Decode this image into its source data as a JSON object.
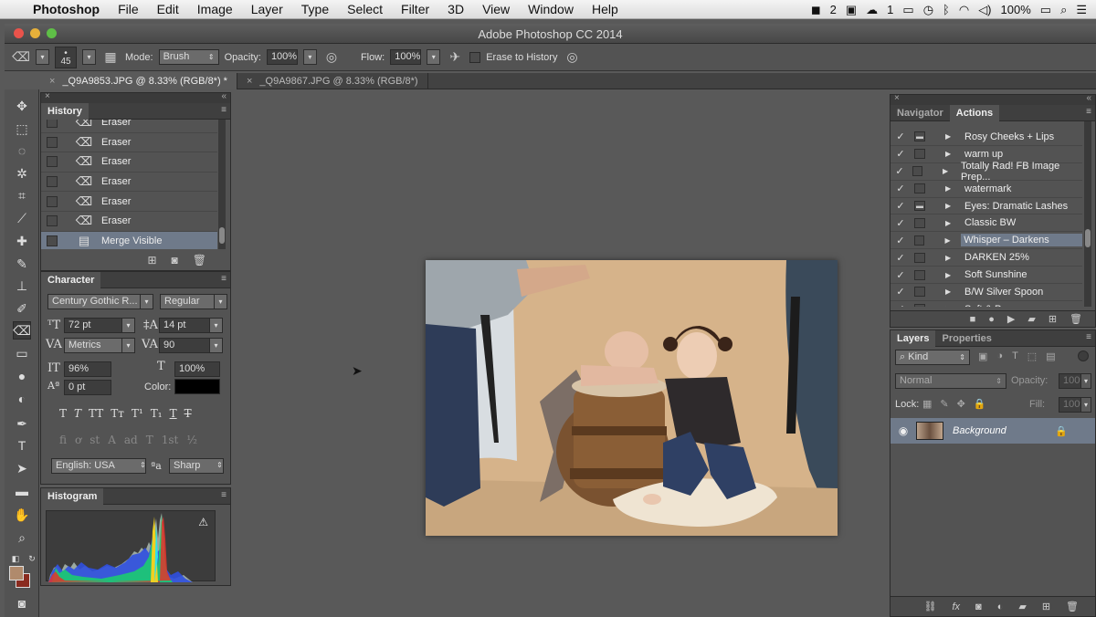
{
  "menubar": {
    "app": "Photoshop",
    "items": [
      "File",
      "Edit",
      "Image",
      "Layer",
      "Type",
      "Select",
      "Filter",
      "3D",
      "View",
      "Window",
      "Help"
    ],
    "status": {
      "badge_count": "2",
      "cloud_count": "1",
      "battery": "100%"
    }
  },
  "window": {
    "title": "Adobe Photoshop CC 2014"
  },
  "options": {
    "brush_size": "45",
    "mode_label": "Mode:",
    "mode_value": "Brush",
    "opacity_label": "Opacity:",
    "opacity_value": "100%",
    "flow_label": "Flow:",
    "flow_value": "100%",
    "erase_history_label": "Erase to History"
  },
  "doc_tabs": [
    {
      "label": "_Q9A9853.JPG @ 8.33% (RGB/8*) *"
    },
    {
      "label": "_Q9A9867.JPG @ 8.33% (RGB/8*)"
    }
  ],
  "history": {
    "tab": "History",
    "rows": [
      "Eraser",
      "Eraser",
      "Eraser",
      "Eraser",
      "Eraser",
      "Eraser",
      "Merge Visible"
    ],
    "selected_index": 6
  },
  "character": {
    "tab": "Character",
    "font_family": "Century Gothic R...",
    "font_style": "Regular",
    "font_size": "72 pt",
    "leading": "14 pt",
    "kerning": "Metrics",
    "tracking": "90",
    "vert_scale": "96%",
    "horiz_scale": "100%",
    "baseline": "0 pt",
    "color_label": "Color:",
    "color_value": "#000000",
    "language": "English: USA",
    "aa_label": "a",
    "antialias": "Sharp"
  },
  "histogram": {
    "tab": "Histogram"
  },
  "right_panel": {
    "tabs": [
      "Navigator",
      "Actions"
    ],
    "active_tab": "Actions",
    "actions": [
      {
        "name": "Rosy Cheeks + Lips",
        "dialog": true
      },
      {
        "name": "warm up",
        "dialog": false
      },
      {
        "name": "Totally Rad! FB Image Prep...",
        "dialog": false
      },
      {
        "name": "watermark",
        "dialog": false
      },
      {
        "name": "Eyes: Dramatic Lashes",
        "dialog": true
      },
      {
        "name": "Classic BW",
        "dialog": false
      },
      {
        "name": "Whisper – Darkens",
        "dialog": false
      },
      {
        "name": "DARKEN 25%",
        "dialog": false
      },
      {
        "name": "Soft Sunshine",
        "dialog": false
      },
      {
        "name": "B/W Silver Spoon",
        "dialog": false
      },
      {
        "name": "Soft & Pure",
        "dialog": false
      }
    ],
    "selected_action": 6
  },
  "layers": {
    "tabs": [
      "Layers",
      "Properties"
    ],
    "kind": "Kind",
    "blend": "Normal",
    "opacity_label": "Opacity:",
    "opacity_value": "100%",
    "lock_label": "Lock:",
    "fill_label": "Fill:",
    "fill_value": "100%",
    "layer_name": "Background"
  },
  "colors": {
    "foreground": "#b08a6c",
    "background": "#8a2b1f",
    "selection": "#6f7a8a"
  }
}
